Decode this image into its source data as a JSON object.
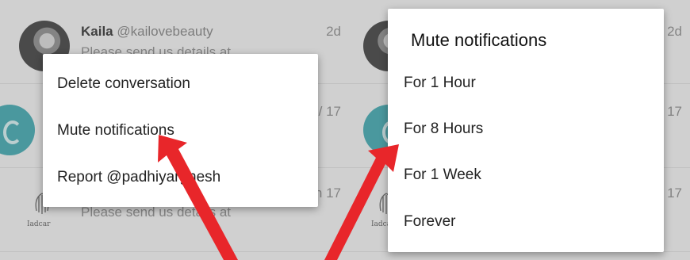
{
  "left_screen": {
    "conversations": [
      {
        "name": "Kaila",
        "handle": "@kailovebeauty",
        "preview": "Please send us details at",
        "time": "2d"
      },
      {
        "name": "",
        "handle": "",
        "preview": "",
        "time": "/ 17"
      },
      {
        "name": "",
        "handle": "",
        "preview": "Please send us details at",
        "time": "n 17"
      }
    ],
    "avatar_logo_text": "Iadcar",
    "context_menu": {
      "items": [
        "Delete conversation",
        "Mute notifications",
        "Report @padhiyargnesh"
      ]
    }
  },
  "right_screen": {
    "times": [
      "2d",
      "17",
      "17"
    ],
    "avatar_logo_text": "Iadcar",
    "mute_dialog": {
      "title": "Mute notifications",
      "options": [
        "For 1 Hour",
        "For 8 Hours",
        "For 1 Week",
        "Forever"
      ]
    }
  },
  "colors": {
    "arrow": "#e8262a",
    "teal_avatar": "#3aa6ad",
    "dim_overlay": "rgba(120,120,120,0.28)"
  },
  "icons": [
    "profile-photo-avatar",
    "teal-letter-avatar",
    "brand-logo-avatar",
    "red-pointer-arrow"
  ]
}
